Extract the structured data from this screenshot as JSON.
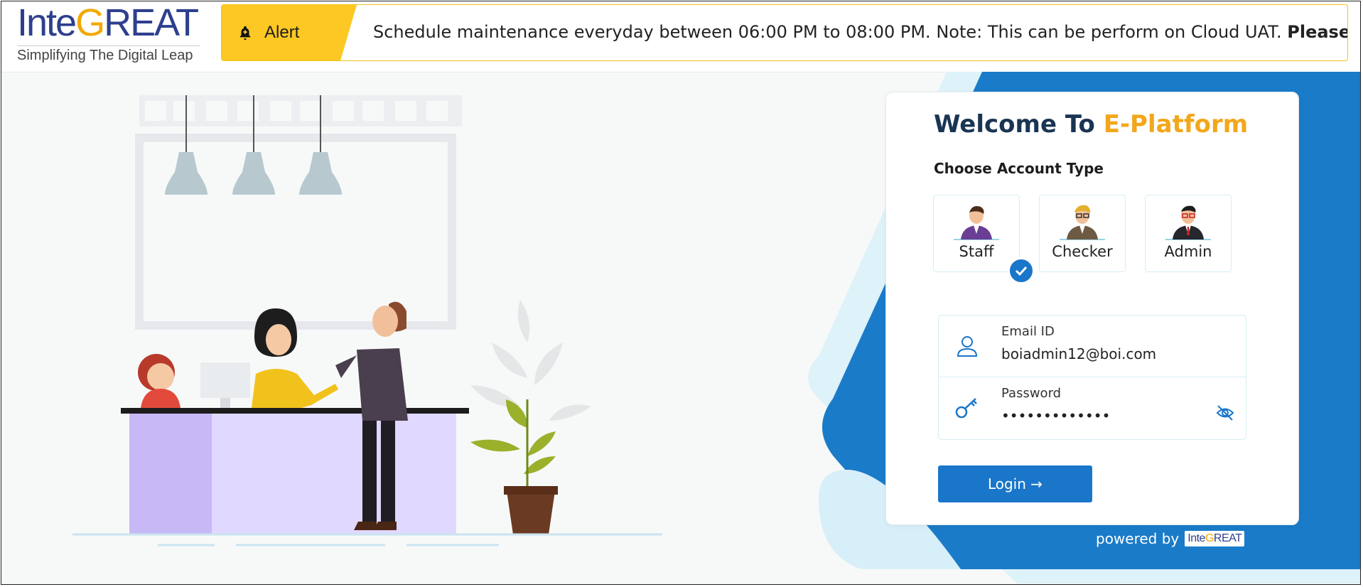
{
  "header": {
    "logo_inte": "Inte",
    "logo_g": "G",
    "logo_reat": "REAT",
    "tagline": "Simplifying The Digital Leap"
  },
  "alert": {
    "label": "Alert",
    "message": "Schedule maintenance everyday between 06:00 PM to 08:00 PM. Note: This can be perform on Cloud UAT. ",
    "message_bold": "Please reach ou"
  },
  "login": {
    "welcome_prefix": "Welcome To ",
    "welcome_brand": "E-Platform",
    "choose_label": "Choose Account Type",
    "account_types": [
      "Staff",
      "Checker",
      "Admin"
    ],
    "selected_account": "Staff",
    "email_label": "Email ID",
    "email_value": "boiadmin12@boi.com",
    "password_label": "Password",
    "password_value": "•••••••••••••",
    "login_button": "Login →"
  },
  "footer": {
    "powered_by": "powered by",
    "powered_logo_inte": "Inte",
    "powered_logo_g": "G",
    "powered_logo_reat": "REAT"
  },
  "colors": {
    "primary": "#1a76c9",
    "accent": "#f2a71b",
    "alert": "#fdc823",
    "heading": "#1a3453"
  },
  "icons": [
    "bell-icon",
    "user-icon",
    "key-icon",
    "eye-off-icon",
    "check-icon",
    "arrow-right-icon"
  ]
}
